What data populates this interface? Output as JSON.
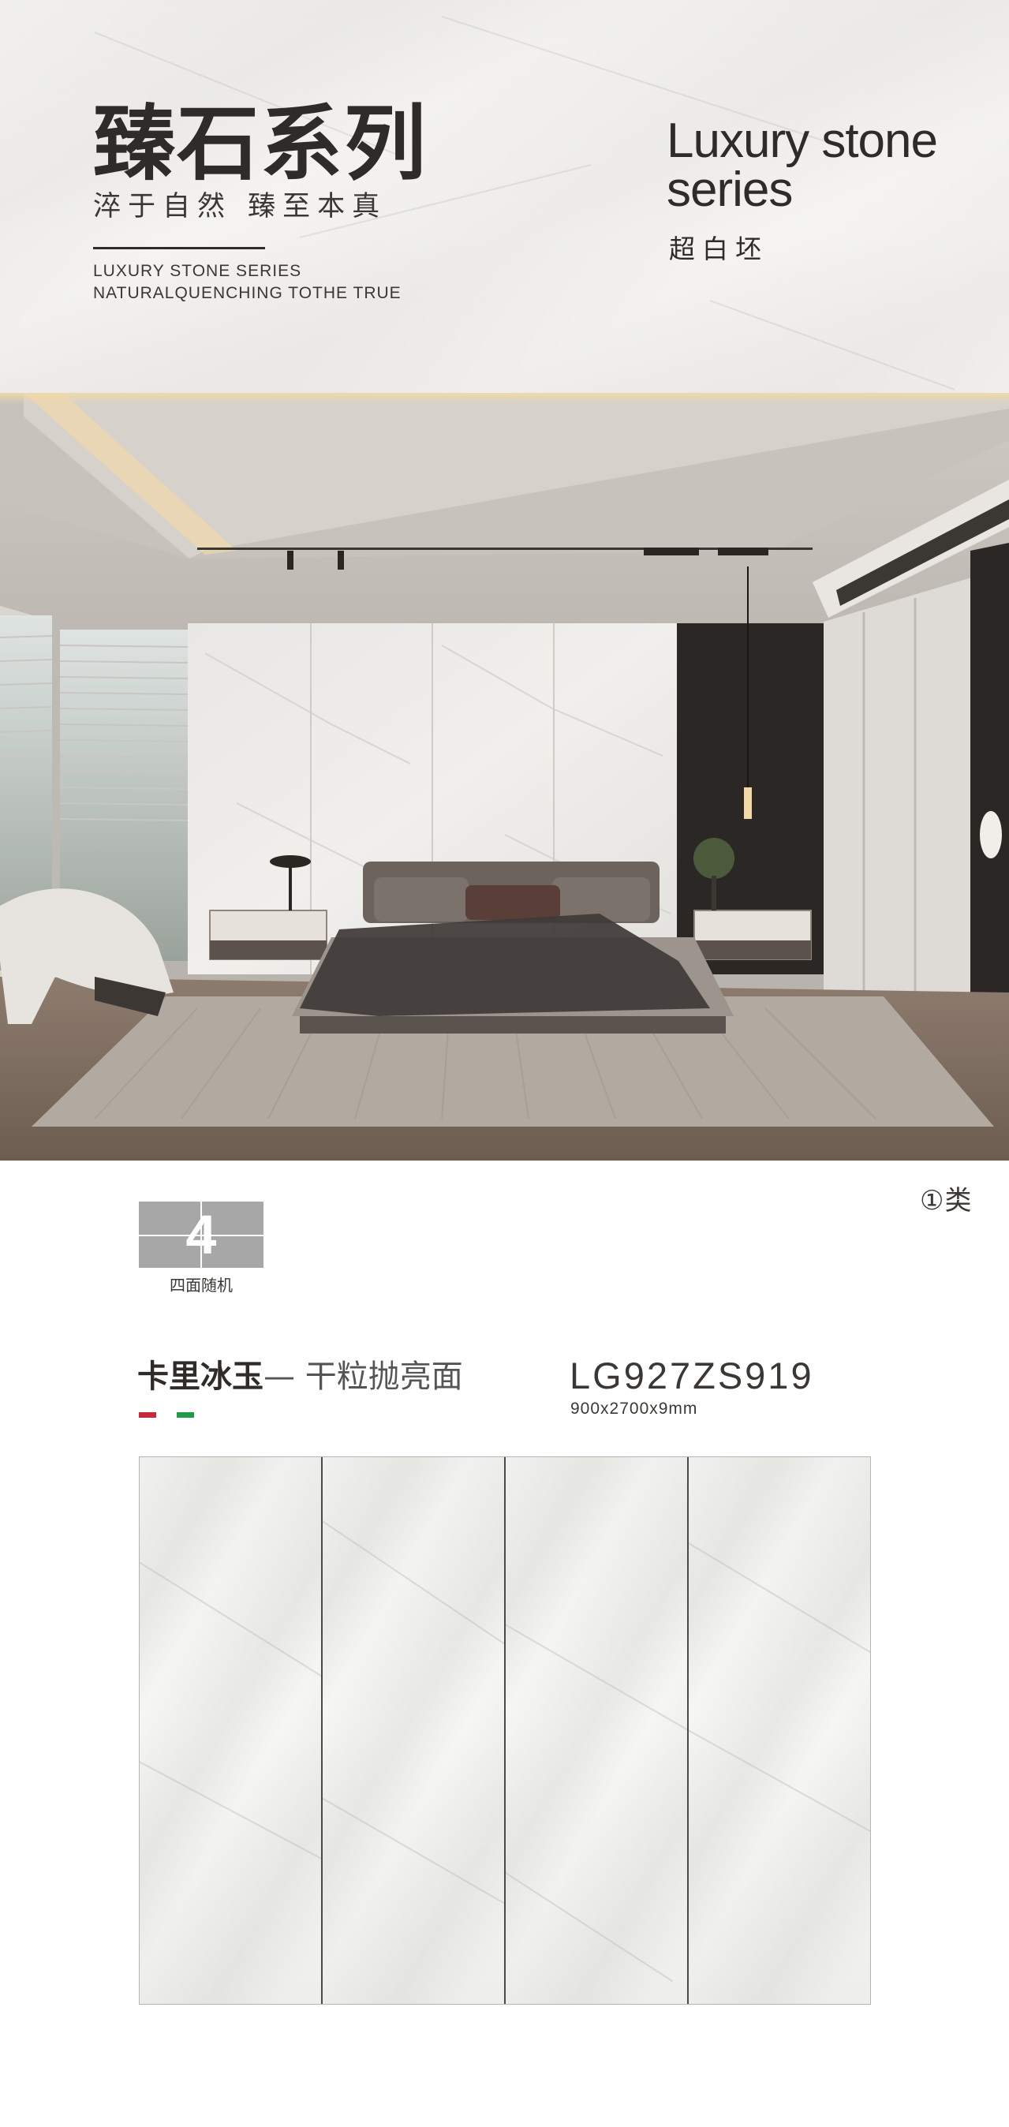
{
  "header": {
    "title_cn": "臻石系列",
    "subtitle_cn": "淬于自然 臻至本真",
    "en_line1": "LUXURY STONE SERIES",
    "en_line2": "NATURALQUENCHING TOTHE TRUE",
    "lux_title_line1": "Luxury stone",
    "lux_title_line2": "series",
    "lux_subtitle": "超白坯"
  },
  "info": {
    "category": "①类",
    "face_count": "4",
    "face_label": "四面随机",
    "product_name": "卡里冰玉",
    "product_dash": "—",
    "product_finish": "干粒抛亮面",
    "code": "LG927ZS919",
    "size": "900x2700x9mm",
    "flag_colors": [
      "#c8283a",
      "#ffffff",
      "#1e9a4a"
    ]
  },
  "tiles": {
    "count": 4
  }
}
